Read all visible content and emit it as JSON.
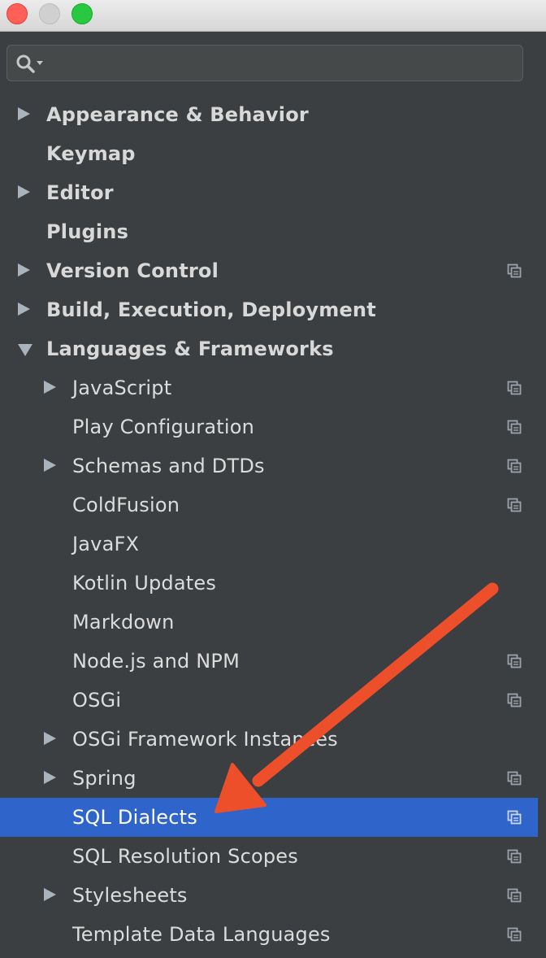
{
  "search": {
    "value": "",
    "placeholder": ""
  },
  "colors": {
    "background": "#3c3f41",
    "selected": "#2f65ca",
    "annotation_arrow": "#ee4f2b"
  },
  "tree": [
    {
      "id": "appearance",
      "label": "Appearance & Behavior",
      "level": 0,
      "arrow": "right",
      "bold": true,
      "project_icon": false
    },
    {
      "id": "keymap",
      "label": "Keymap",
      "level": 0,
      "arrow": "none",
      "bold": true,
      "project_icon": false
    },
    {
      "id": "editor",
      "label": "Editor",
      "level": 0,
      "arrow": "right",
      "bold": true,
      "project_icon": false
    },
    {
      "id": "plugins",
      "label": "Plugins",
      "level": 0,
      "arrow": "none",
      "bold": true,
      "project_icon": false
    },
    {
      "id": "version-control",
      "label": "Version Control",
      "level": 0,
      "arrow": "right",
      "bold": true,
      "project_icon": true
    },
    {
      "id": "build",
      "label": "Build, Execution, Deployment",
      "level": 0,
      "arrow": "right",
      "bold": true,
      "project_icon": false
    },
    {
      "id": "languages",
      "label": "Languages & Frameworks",
      "level": 0,
      "arrow": "down",
      "bold": true,
      "project_icon": false
    },
    {
      "id": "javascript",
      "label": "JavaScript",
      "level": 1,
      "arrow": "right",
      "bold": false,
      "project_icon": true
    },
    {
      "id": "play",
      "label": "Play Configuration",
      "level": 1,
      "arrow": "none",
      "bold": false,
      "project_icon": true
    },
    {
      "id": "schemas",
      "label": "Schemas and DTDs",
      "level": 1,
      "arrow": "right",
      "bold": false,
      "project_icon": true
    },
    {
      "id": "coldfusion",
      "label": "ColdFusion",
      "level": 1,
      "arrow": "none",
      "bold": false,
      "project_icon": true
    },
    {
      "id": "javafx",
      "label": "JavaFX",
      "level": 1,
      "arrow": "none",
      "bold": false,
      "project_icon": false
    },
    {
      "id": "kotlin",
      "label": "Kotlin Updates",
      "level": 1,
      "arrow": "none",
      "bold": false,
      "project_icon": false
    },
    {
      "id": "markdown",
      "label": "Markdown",
      "level": 1,
      "arrow": "none",
      "bold": false,
      "project_icon": false
    },
    {
      "id": "nodejs",
      "label": "Node.js and NPM",
      "level": 1,
      "arrow": "none",
      "bold": false,
      "project_icon": true
    },
    {
      "id": "osgi",
      "label": "OSGi",
      "level": 1,
      "arrow": "none",
      "bold": false,
      "project_icon": true
    },
    {
      "id": "osgi-framework",
      "label": "OSGi Framework Instances",
      "level": 1,
      "arrow": "right",
      "bold": false,
      "project_icon": false
    },
    {
      "id": "spring",
      "label": "Spring",
      "level": 1,
      "arrow": "right",
      "bold": false,
      "project_icon": true
    },
    {
      "id": "sql-dialects",
      "label": "SQL Dialects",
      "level": 1,
      "arrow": "none",
      "bold": false,
      "project_icon": true,
      "selected": true
    },
    {
      "id": "sql-resolution",
      "label": "SQL Resolution Scopes",
      "level": 1,
      "arrow": "none",
      "bold": false,
      "project_icon": true
    },
    {
      "id": "stylesheets",
      "label": "Stylesheets",
      "level": 1,
      "arrow": "right",
      "bold": false,
      "project_icon": true
    },
    {
      "id": "template-data",
      "label": "Template Data Languages",
      "level": 1,
      "arrow": "none",
      "bold": false,
      "project_icon": true
    }
  ]
}
